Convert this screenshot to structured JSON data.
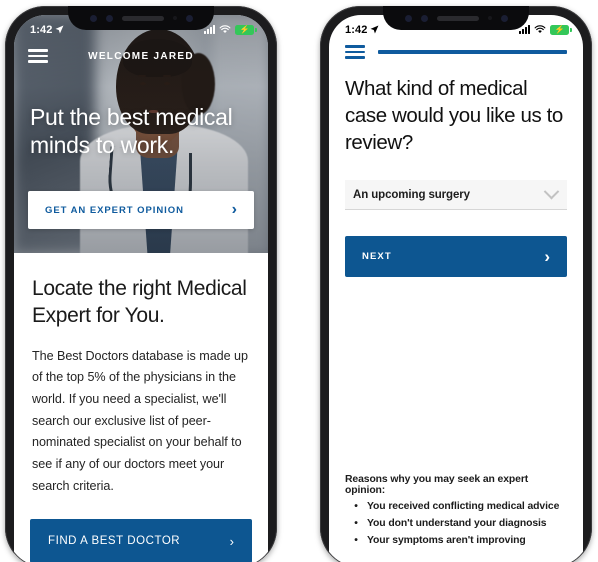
{
  "phone1": {
    "statusbar": {
      "time": "1:42",
      "location_icon": "location-arrow-icon",
      "signal_icon": "cellular-signal-icon",
      "wifi_icon": "wifi-icon",
      "battery_icon": "battery-charging-icon"
    },
    "nav": {
      "menu_icon": "hamburger-menu-icon",
      "welcome_label": "WELCOME JARED"
    },
    "hero": {
      "headline": "Put the best medical minds to work.",
      "cta_label": "GET AN EXPERT OPINION",
      "cta_icon": "chevron-right-icon"
    },
    "content": {
      "heading": "Locate the right Medical Expert for You.",
      "paragraph": "The Best Doctors database is made up of the top 5% of the physicians in the world. If you need a specialist, we'll search our exclusive list of peer-nominated specialist on your behalf to see if any of our doctors meet your search criteria.",
      "button_label": "FIND A BEST DOCTOR",
      "button_icon": "chevron-right-icon"
    }
  },
  "phone2": {
    "statusbar": {
      "time": "1:42",
      "location_icon": "location-arrow-icon",
      "signal_icon": "cellular-signal-icon",
      "wifi_icon": "wifi-icon",
      "battery_icon": "battery-charging-icon"
    },
    "nav": {
      "menu_icon": "hamburger-menu-icon",
      "progress_label": ""
    },
    "question": "What kind of medical case would you like us to review?",
    "select": {
      "value": "An upcoming surgery",
      "caret_icon": "chevron-down-icon",
      "options": [
        "An upcoming surgery"
      ]
    },
    "next_button": {
      "label": "NEXT",
      "icon": "chevron-right-icon"
    },
    "reasons": {
      "title": "Reasons why you may seek an expert opinion:",
      "items": [
        "You received conflicting medical advice",
        "You don't understand your diagnosis",
        "Your symptoms aren't improving"
      ]
    }
  },
  "colors": {
    "brand_blue": "#0d5691",
    "link_blue": "#0f5b9e",
    "battery_green": "#34c759"
  }
}
